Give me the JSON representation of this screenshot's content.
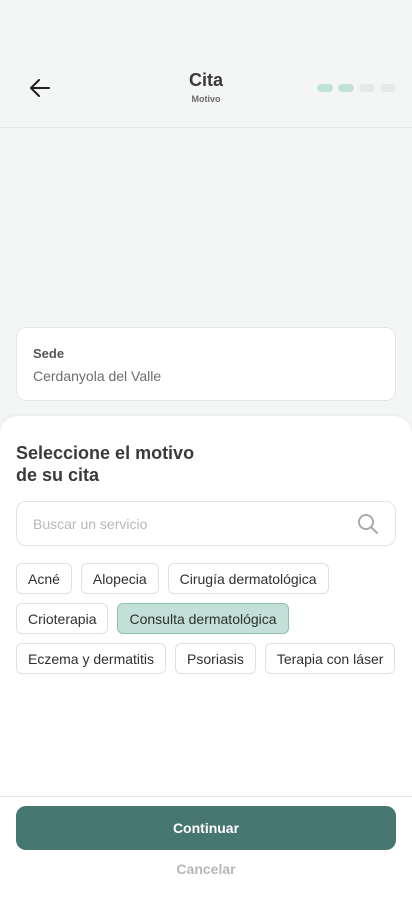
{
  "header": {
    "title": "Cita",
    "subtitle": "Motivo",
    "back_icon": "arrow-left-icon",
    "progress": {
      "total_steps": 4,
      "completed_steps": 2,
      "active_color": "#c2e1d9",
      "inactive_color": "#e6e9e8"
    }
  },
  "sede": {
    "label": "Sede",
    "value": "Cerdanyola del Valle"
  },
  "sheet": {
    "title_line1": "Seleccione el motivo",
    "title_line2": "de su cita",
    "search": {
      "placeholder": "Buscar un servicio",
      "value": "",
      "icon": "search-icon"
    },
    "services": [
      {
        "label": "Acné",
        "selected": false
      },
      {
        "label": "Alopecia",
        "selected": false
      },
      {
        "label": "Cirugía dermatológica",
        "selected": false
      },
      {
        "label": "Crioterapia",
        "selected": false
      },
      {
        "label": "Consulta dermatológica",
        "selected": true
      },
      {
        "label": "Eczema y dermatitis",
        "selected": false
      },
      {
        "label": "Psoriasis",
        "selected": false
      },
      {
        "label": "Terapia con láser",
        "selected": false
      }
    ]
  },
  "footer": {
    "continue_label": "Continuar",
    "cancel_label": "Cancelar"
  },
  "colors": {
    "primary": "#457770",
    "selected_chip": "#c3e0d8",
    "background": "#f4f6f5"
  }
}
